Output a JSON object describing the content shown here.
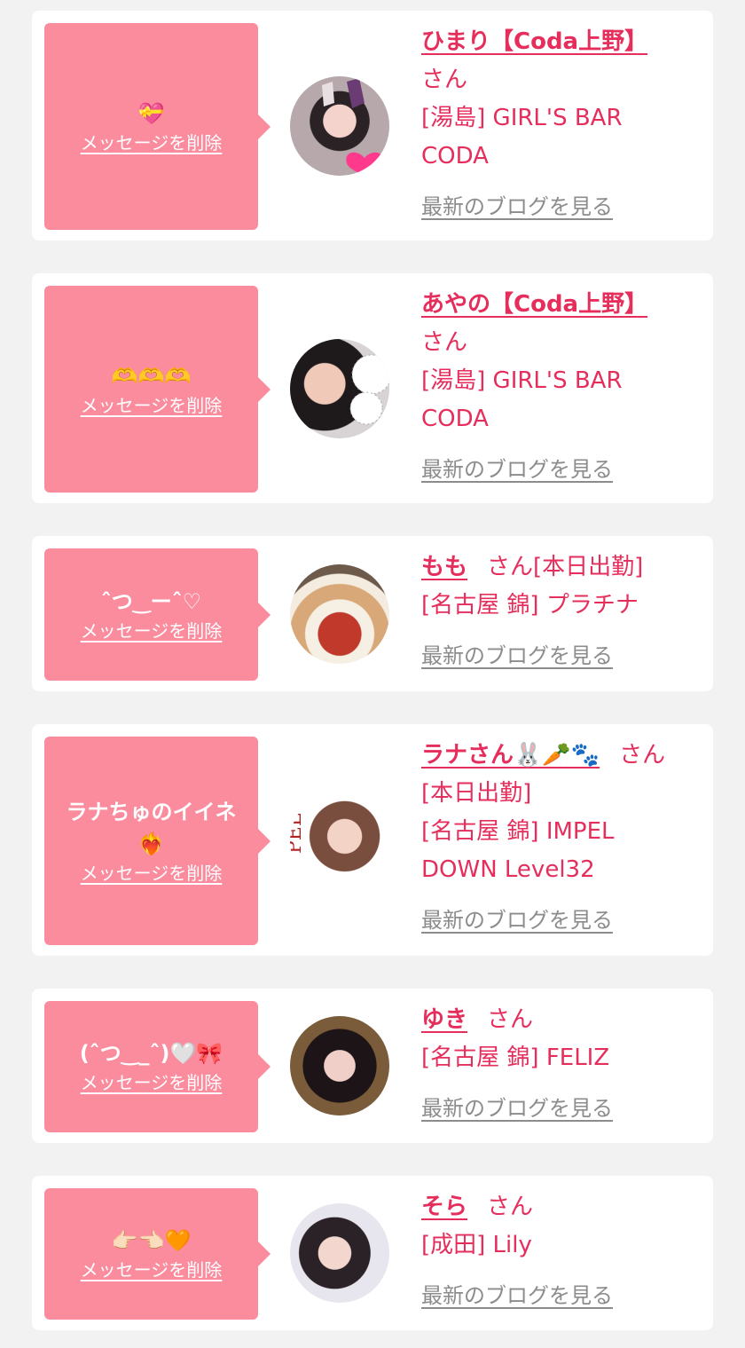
{
  "common": {
    "delete_label": "メッセージを削除",
    "blog_label": "最新のブログを見る",
    "san": "さん"
  },
  "cards": [
    {
      "message": "💝",
      "name": "ひまり【Coda上野】",
      "status": "",
      "shop_lines": [
        "[湯島] GIRL'S BAR",
        "CODA"
      ]
    },
    {
      "message": "🫶🫶🫶",
      "name": "あやの【Coda上野】",
      "status": "",
      "shop_lines": [
        "[湯島] GIRL'S BAR",
        "CODA"
      ]
    },
    {
      "message": "ˆつ‿ーˆ♡",
      "name": "もも",
      "status": "[本日出勤]",
      "shop_lines": [
        "[名古屋 錦] プラチナ"
      ]
    },
    {
      "message": "ラナちゅのイイネ",
      "message2": "❤️‍🔥",
      "name": "ラナさん🐰🥕🐾",
      "status": "[本日出勤]",
      "shop_lines": [
        "[名古屋 錦] IMPEL",
        "DOWN Level32"
      ]
    },
    {
      "message": "(ˆつ‿_ˆ)🤍🎀",
      "name": "ゆき",
      "status": "",
      "shop_lines": [
        "[名古屋 錦] FELIZ"
      ]
    },
    {
      "message": "👉🏻👈🏻🧡",
      "name": "そら",
      "status": "",
      "shop_lines": [
        "[成田] Lily"
      ]
    }
  ],
  "colors": {
    "bubble": "#fa8c9e",
    "accent": "#e52e5c",
    "link_gray": "#8c8c8c",
    "background": "#f2f2f2"
  }
}
